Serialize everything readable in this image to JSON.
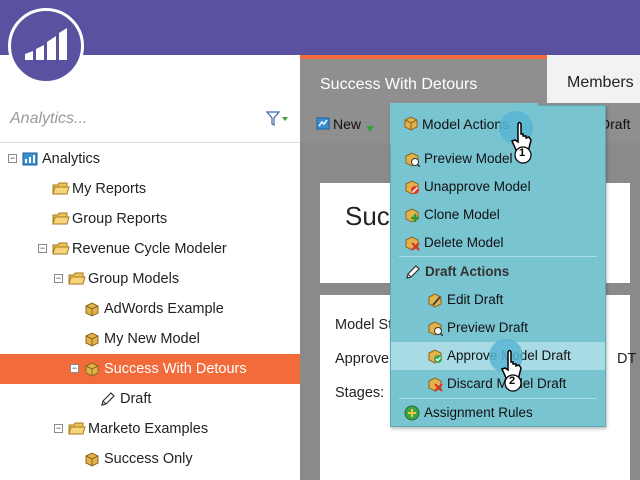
{
  "left": {
    "search": {
      "placeholder": "Analytics..."
    },
    "tree": [
      {
        "label": "Analytics",
        "icon": "analytics-root-icon",
        "expander": "minus"
      },
      {
        "label": "My Reports",
        "icon": "folder-icon"
      },
      {
        "label": "Group Reports",
        "icon": "folder-icon"
      },
      {
        "label": "Revenue Cycle Modeler",
        "icon": "folder-icon",
        "expander": "minus"
      },
      {
        "label": "Group Models",
        "icon": "folder-icon",
        "expander": "minus"
      },
      {
        "label": "AdWords Example",
        "icon": "model-cube-icon"
      },
      {
        "label": "My New Model",
        "icon": "model-cube-icon"
      },
      {
        "label": "Success With Detours",
        "icon": "model-cube-icon",
        "expander": "minus",
        "selected": true
      },
      {
        "label": "Draft",
        "icon": "pencil-icon"
      },
      {
        "label": "Marketo Examples",
        "icon": "folder-icon",
        "expander": "minus"
      },
      {
        "label": "Success Only",
        "icon": "model-cube-icon"
      }
    ]
  },
  "tabs": {
    "active": "Success With Detours",
    "second": "Members"
  },
  "toolbar": {
    "new_label": "New",
    "model_actions_label": "Model Actions",
    "edit_draft_label": "Edit Draft"
  },
  "card1": {
    "title_partial": "Succ"
  },
  "card2": {
    "model_status": "Model St",
    "approved": "Approve",
    "stages": "Stages:",
    "tz": "DT"
  },
  "menu": {
    "title": "Model Actions",
    "items_top": [
      "Preview Model",
      "Unapprove Model",
      "Clone Model",
      "Delete Model"
    ],
    "draft_header": "Draft Actions",
    "items_draft": [
      "Edit Draft",
      "Preview Draft",
      "Approve Model Draft",
      "Discard Model Draft"
    ],
    "items_bottom": [
      "Assignment Rules"
    ]
  },
  "callouts": {
    "step1": "1",
    "step2": "2"
  },
  "colors": {
    "header": "#5a52a0",
    "selected": "#f26b3a",
    "menu": "#79c4d1",
    "menu_highlight": "#a8dbe3"
  }
}
